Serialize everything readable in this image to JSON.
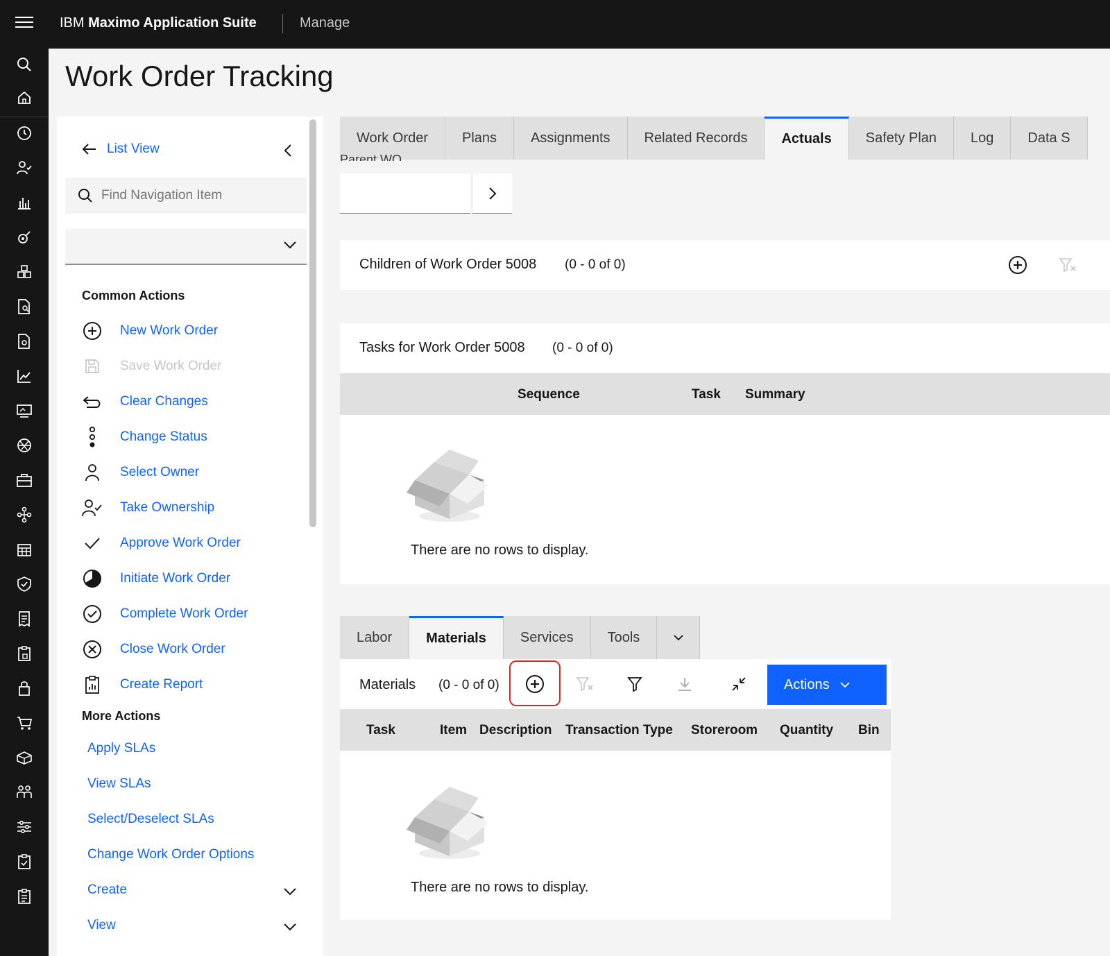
{
  "header": {
    "brand_prefix": "IBM",
    "brand_name": "Maximo Application Suite",
    "app_name": "Manage"
  },
  "page_title": "Work Order Tracking",
  "nav": {
    "list_view": "List View",
    "find_placeholder": "Find Navigation Item",
    "common_actions_title": "Common Actions",
    "common_actions": [
      {
        "label": "New Work Order",
        "icon": "add-circle-icon",
        "enabled": true
      },
      {
        "label": "Save Work Order",
        "icon": "save-icon",
        "enabled": false
      },
      {
        "label": "Clear Changes",
        "icon": "undo-icon",
        "enabled": true
      },
      {
        "label": "Change Status",
        "icon": "status-dots-icon",
        "enabled": true
      },
      {
        "label": "Select Owner",
        "icon": "user-icon",
        "enabled": true
      },
      {
        "label": "Take Ownership",
        "icon": "user-check-icon",
        "enabled": true
      },
      {
        "label": "Approve Work Order",
        "icon": "checkmark-icon",
        "enabled": true
      },
      {
        "label": "Initiate Work Order",
        "icon": "half-circle-icon",
        "enabled": true
      },
      {
        "label": "Complete Work Order",
        "icon": "check-circle-icon",
        "enabled": true
      },
      {
        "label": "Close Work Order",
        "icon": "close-circle-icon",
        "enabled": true
      },
      {
        "label": "Create Report",
        "icon": "report-icon",
        "enabled": true
      }
    ],
    "more_actions_title": "More Actions",
    "more_actions": [
      {
        "label": "Apply SLAs",
        "expandable": false
      },
      {
        "label": "View SLAs",
        "expandable": false
      },
      {
        "label": "Select/Deselect SLAs",
        "expandable": false
      },
      {
        "label": "Change Work Order Options",
        "expandable": false
      },
      {
        "label": "Create",
        "expandable": true
      },
      {
        "label": "View",
        "expandable": true
      }
    ]
  },
  "tabs": [
    "Work Order",
    "Plans",
    "Assignments",
    "Related Records",
    "Actuals",
    "Safety Plan",
    "Log",
    "Data S"
  ],
  "active_tab": "Actuals",
  "parent_wo_label": "Parent WO",
  "children_panel": {
    "title": "Children of Work Order 5008",
    "count": "(0 - 0 of 0)"
  },
  "tasks_panel": {
    "title": "Tasks for Work Order 5008",
    "count": "(0 - 0 of 0)",
    "columns": [
      "Sequence",
      "Task",
      "Summary"
    ],
    "empty_message": "There are no rows to display."
  },
  "sub_tabs": [
    "Labor",
    "Materials",
    "Services",
    "Tools"
  ],
  "active_sub_tab": "Materials",
  "materials_panel": {
    "title": "Materials",
    "count": "(0 - 0 of 0)",
    "actions_label": "Actions",
    "columns": [
      "Task",
      "Item",
      "Description",
      "Transaction Type",
      "Storeroom",
      "Quantity",
      "Bin"
    ],
    "empty_message": "There are no rows to display."
  },
  "colors": {
    "accent": "#0f62fe",
    "highlight": "#e0281e",
    "header_bg": "#161616"
  }
}
